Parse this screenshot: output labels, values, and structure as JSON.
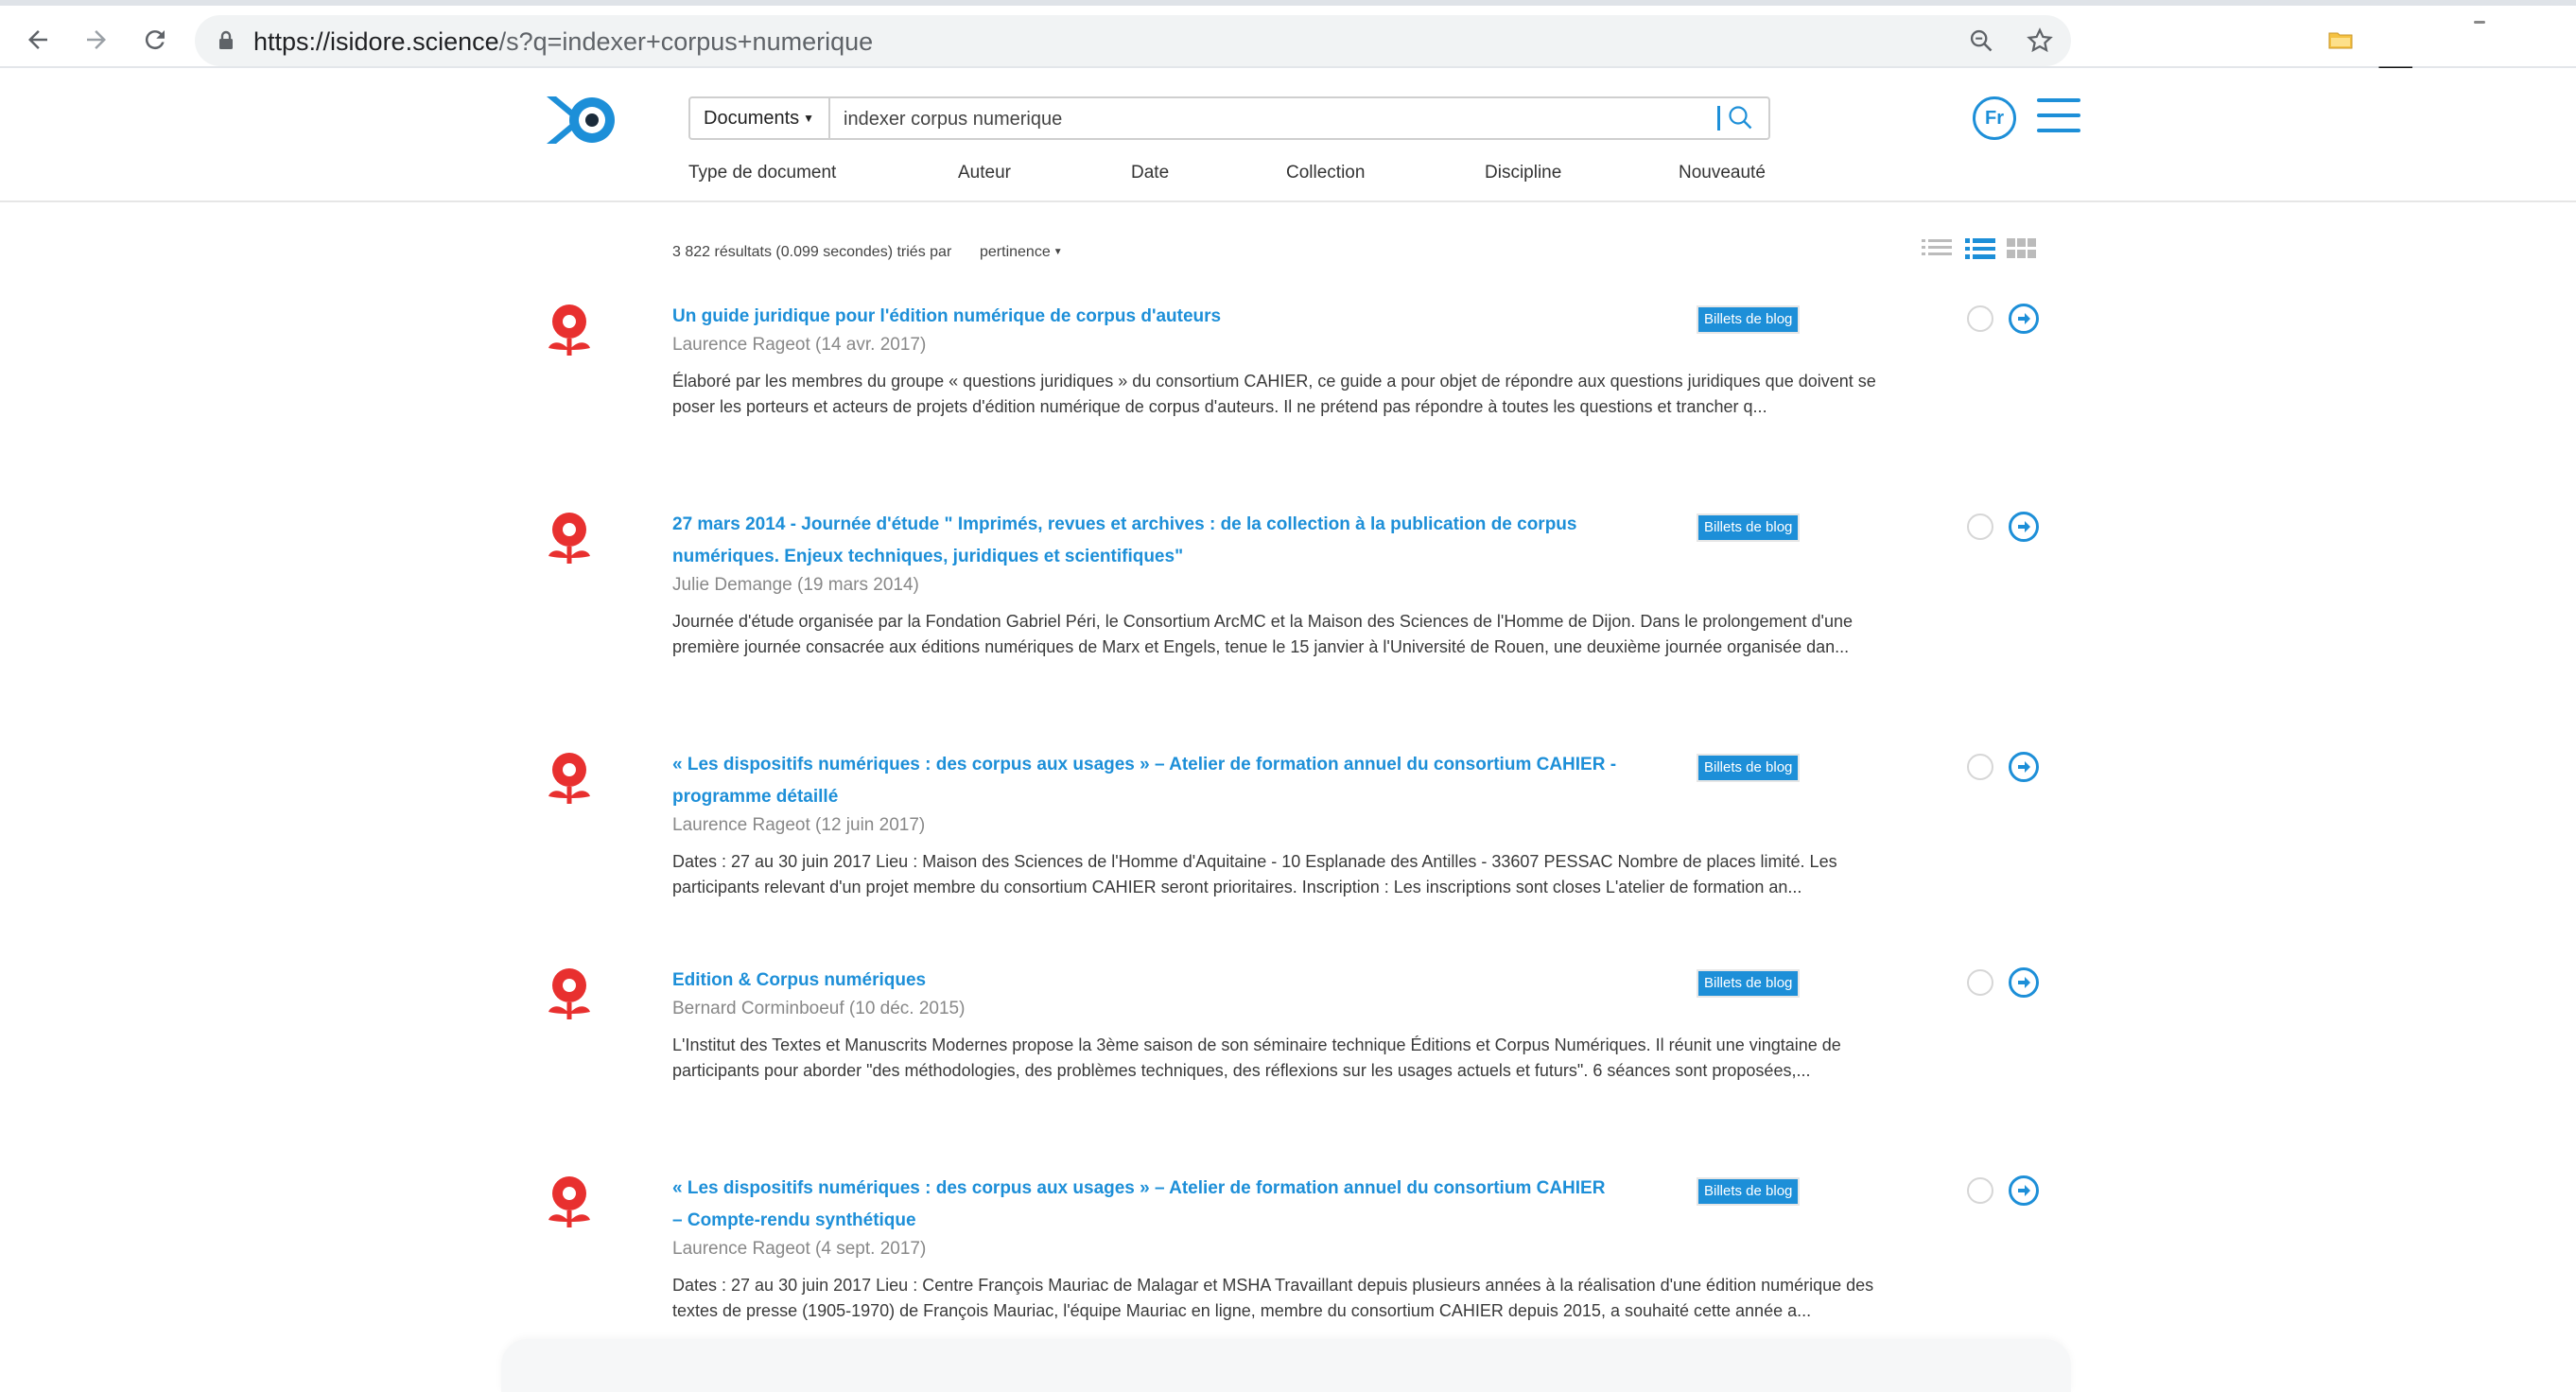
{
  "browser": {
    "url_host": "https://isidore.science",
    "url_path": "/s?q=indexer+corpus+numerique",
    "extension_label": "Zotero"
  },
  "header": {
    "scope_label": "Documents",
    "search_value": "indexer corpus numerique",
    "lang_label": "Fr",
    "facets": [
      "Type de document",
      "Auteur",
      "Date",
      "Collection",
      "Discipline",
      "Nouveauté"
    ]
  },
  "results_meta": {
    "summary": "3 822 résultats (0.099 secondes) triés par",
    "sort_label": "pertinence"
  },
  "results": [
    {
      "title": "Un guide juridique pour l'édition numérique de corpus d'auteurs",
      "author": "Laurence Rageot (14 avr. 2017)",
      "desc": "Élaboré par les membres du groupe « questions juridiques » du consortium CAHIER, ce guide a pour objet de répondre aux questions juridiques que doivent se poser les porteurs et acteurs de projets d'édition numérique de corpus d'auteurs. Il ne prétend pas répondre à toutes les questions et trancher q...",
      "badge": "Billets de blog"
    },
    {
      "title": "27 mars 2014 - Journée d'étude \" Imprimés, revues et archives : de la collection à la publication de corpus numériques. Enjeux techniques, juridiques et scientifiques\"",
      "author": "Julie Demange (19 mars 2014)",
      "desc": "Journée d'étude organisée par la Fondation Gabriel Péri, le Consortium ArcMC et la Maison des Sciences de l'Homme de Dijon. Dans le prolongement d'une première journée consacrée aux éditions numériques de Marx et Engels, tenue le 15 janvier à l'Université de Rouen, une deuxième journée organisée dan...",
      "badge": "Billets de blog"
    },
    {
      "title": "« Les dispositifs numériques : des corpus aux usages » – Atelier de formation annuel du consortium CAHIER - programme détaillé",
      "author": "Laurence Rageot (12 juin 2017)",
      "desc": "Dates : 27 au 30 juin 2017 Lieu : Maison des Sciences de l'Homme d'Aquitaine - 10 Esplanade des Antilles - 33607 PESSAC Nombre de places limité. Les participants relevant d'un projet membre du consortium CAHIER seront prioritaires. Inscription : Les inscriptions sont closes L'atelier de formation an...",
      "badge": "Billets de blog"
    },
    {
      "title": "Edition & Corpus numériques",
      "author": "Bernard Corminboeuf (10 déc. 2015)",
      "desc": "L'Institut des Textes et Manuscrits Modernes propose la 3ème saison de son séminaire technique Éditions et Corpus Numériques. Il réunit une vingtaine de participants pour aborder \"des méthodologies, des problèmes techniques, des réflexions sur les usages actuels et futurs\". 6 séances sont proposées,...",
      "badge": "Billets de blog"
    },
    {
      "title": "« Les dispositifs numériques : des corpus aux usages » – Atelier de formation annuel du consortium CAHIER – Compte-rendu synthétique",
      "author": "Laurence Rageot (4 sept. 2017)",
      "desc": "Dates : 27 au 30 juin 2017 Lieu : Centre François Mauriac de Malagar et MSHA Travaillant depuis plusieurs années à la réalisation d'une édition numérique des textes de presse (1905-1970) de François Mauriac, l'équipe Mauriac en ligne, membre du consortium CAHIER depuis 2015, a souhaité cette année a...",
      "badge": "Billets de blog"
    }
  ],
  "colors": {
    "accent": "#1d8fd8",
    "source_icon": "#e8302f"
  }
}
